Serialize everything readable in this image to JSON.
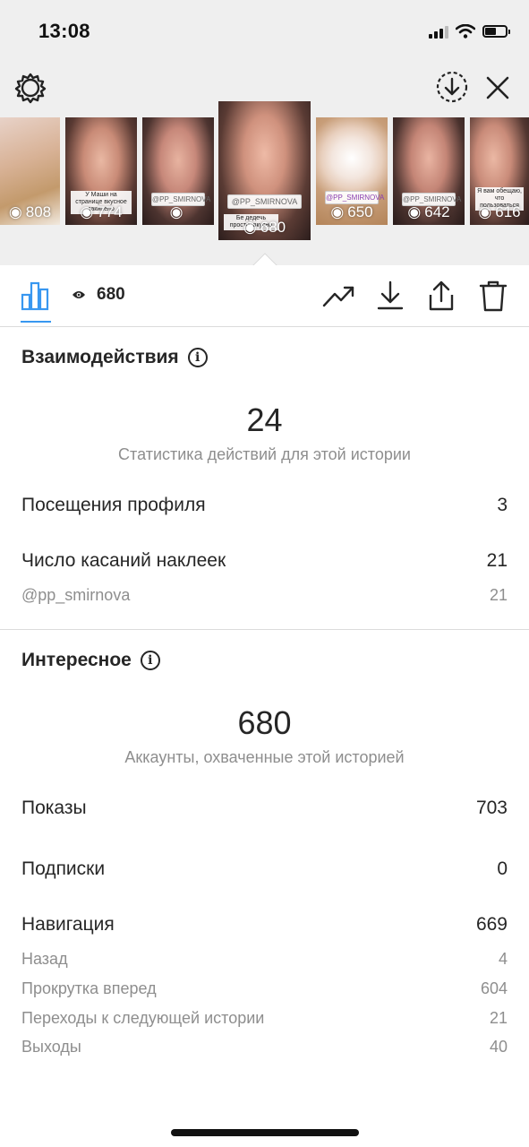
{
  "status_bar": {
    "time": "13:08"
  },
  "top_bar": {
    "settings_icon": "gear-icon",
    "save_icon": "download-circle-icon",
    "close_icon": "close-icon"
  },
  "stories": [
    {
      "views": "808",
      "caption": "",
      "tag": ""
    },
    {
      "views": "774",
      "caption": "У Маши на странице вкусное закипело",
      "tag": ""
    },
    {
      "views": "",
      "caption": "",
      "tag": "@PP_SMIRNOVA"
    },
    {
      "views": "680",
      "caption": "Бе дедечь просто, вкусно",
      "tag": "@PP_SMIRNOVA"
    },
    {
      "views": "650",
      "caption": "",
      "tag": "@PP_SMIRNOVA"
    },
    {
      "views": "642",
      "caption": "",
      "tag": "@PP_SMIRNOVA"
    },
    {
      "views": "616",
      "caption": "Я вам обещаю, что пользоваться",
      "tag": ""
    }
  ],
  "toolbar": {
    "views_count": "680",
    "icons": [
      "bar-chart-icon",
      "eye-icon",
      "trending-icon",
      "download-icon",
      "share-icon",
      "trash-icon"
    ]
  },
  "interactions": {
    "title": "Взаимодействия",
    "total": "24",
    "subtitle": "Статистика действий для этой истории",
    "rows": [
      {
        "label": "Посещения профиля",
        "value": "3"
      },
      {
        "label": "Число касаний наклеек",
        "value": "21"
      }
    ],
    "sub_rows": [
      {
        "label": "@pp_smirnova",
        "value": "21"
      }
    ]
  },
  "discovery": {
    "title": "Интересное",
    "total": "680",
    "subtitle": "Аккаунты, охваченные этой историей",
    "impressions": {
      "label": "Показы",
      "value": "703"
    },
    "follows": {
      "label": "Подписки",
      "value": "0"
    },
    "navigation": {
      "label": "Навигация",
      "value": "669"
    },
    "nav_rows": [
      {
        "label": "Назад",
        "value": "4"
      },
      {
        "label": "Прокрутка вперед",
        "value": "604"
      },
      {
        "label": "Переходы к следующей истории",
        "value": "21"
      },
      {
        "label": "Выходы",
        "value": "40"
      }
    ]
  },
  "colors": {
    "accent": "#3897f0",
    "text": "#262626",
    "muted": "#8e8e8e",
    "top_bg": "#efefef"
  }
}
